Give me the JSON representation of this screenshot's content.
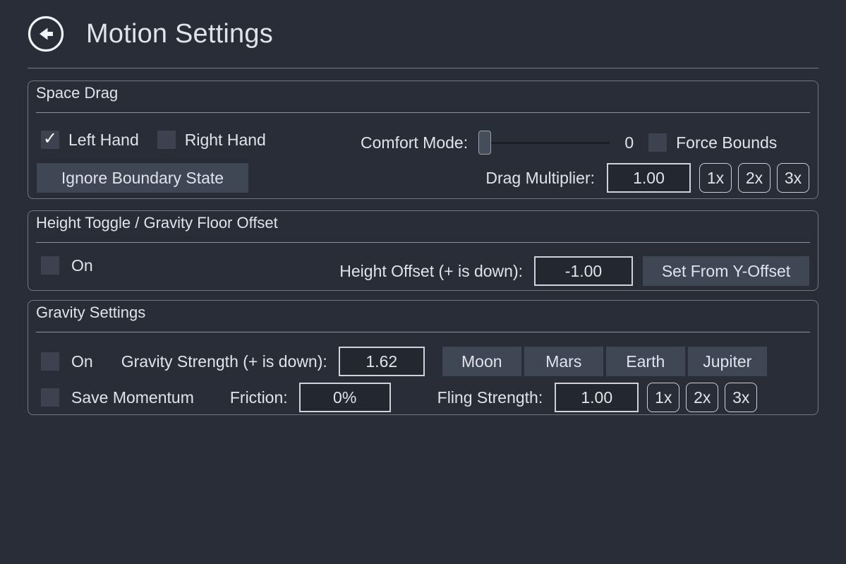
{
  "header": {
    "back_icon": "back-arrow-circle-icon",
    "title": "Motion Settings"
  },
  "colors": {
    "background": "#282d37",
    "panel_border": "#6e7685",
    "text": "#dfe3ea",
    "button_fill": "#3f4654",
    "checkbox_fill": "#3c4250",
    "field_fill": "#222730",
    "field_border": "#cdd3dc"
  },
  "sections": {
    "space_drag": {
      "title": "Space Drag",
      "left_hand": {
        "label": "Left Hand",
        "checked": true
      },
      "right_hand": {
        "label": "Right Hand",
        "checked": false
      },
      "comfort_mode": {
        "label": "Comfort Mode:",
        "value": "0",
        "percent": 0
      },
      "force_bounds": {
        "label": "Force Bounds",
        "checked": false
      },
      "ignore_boundary_state": {
        "label": "Ignore Boundary State"
      },
      "drag_multiplier": {
        "label": "Drag Multiplier:",
        "value": "1.00",
        "presets": [
          "1x",
          "2x",
          "3x"
        ]
      }
    },
    "height_toggle": {
      "title": "Height Toggle / Gravity Floor Offset",
      "on": {
        "label": "On",
        "checked": false
      },
      "height_offset": {
        "label": "Height Offset (+ is down):",
        "value": "-1.00"
      },
      "set_from_y_offset": {
        "label": "Set From Y-Offset"
      }
    },
    "gravity": {
      "title": "Gravity Settings",
      "on": {
        "label": "On",
        "checked": false
      },
      "gravity_strength": {
        "label": "Gravity Strength (+ is down):",
        "value": "1.62"
      },
      "presets": [
        "Moon",
        "Mars",
        "Earth",
        "Jupiter"
      ],
      "save_momentum": {
        "label": "Save Momentum",
        "checked": false
      },
      "friction": {
        "label": "Friction:",
        "value": "0%"
      },
      "fling_strength": {
        "label": "Fling Strength:",
        "value": "1.00",
        "presets": [
          "1x",
          "2x",
          "3x"
        ]
      }
    }
  }
}
